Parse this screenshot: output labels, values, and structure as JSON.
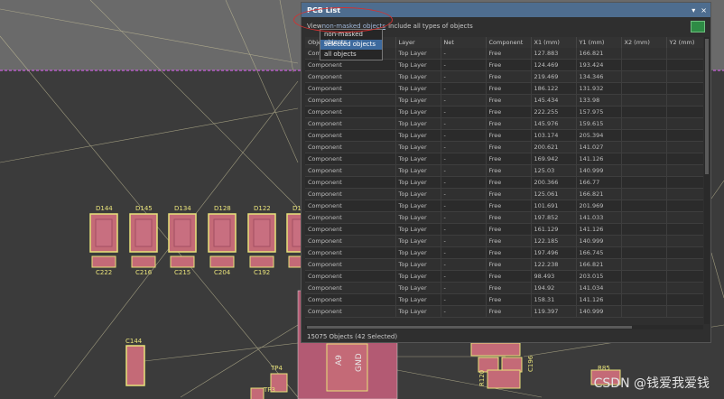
{
  "panel": {
    "title": "PCB List",
    "minimize_glyph": "▾",
    "close_glyph": "×",
    "filter_prefix": "View ",
    "filter_selected": "non-masked objects",
    "filter_include_text": "include all types of objects",
    "export_icon": "excel-export-icon",
    "status": "15075 Objects (42 Selected)"
  },
  "dropdown": {
    "options": [
      "non-masked objects",
      "selected objects",
      "all objects"
    ],
    "highlighted_index": 1
  },
  "table": {
    "columns": [
      "Object Kind",
      "Layer",
      "Net",
      "Component",
      "X1 (mm)",
      "Y1 (mm)",
      "X2 (mm)",
      "Y2 (mm)"
    ],
    "rows": [
      [
        "Component",
        "Top Layer",
        "-",
        "Free",
        "127.883",
        "166.821",
        "",
        ""
      ],
      [
        "Component",
        "Top Layer",
        "-",
        "Free",
        "124.469",
        "193.424",
        "",
        ""
      ],
      [
        "Component",
        "Top Layer",
        "-",
        "Free",
        "219.469",
        "134.346",
        "",
        ""
      ],
      [
        "Component",
        "Top Layer",
        "-",
        "Free",
        "186.122",
        "131.932",
        "",
        ""
      ],
      [
        "Component",
        "Top Layer",
        "-",
        "Free",
        "145.434",
        "133.98",
        "",
        ""
      ],
      [
        "Component",
        "Top Layer",
        "-",
        "Free",
        "222.255",
        "157.975",
        "",
        ""
      ],
      [
        "Component",
        "Top Layer",
        "-",
        "Free",
        "145.976",
        "159.615",
        "",
        ""
      ],
      [
        "Component",
        "Top Layer",
        "-",
        "Free",
        "103.174",
        "205.394",
        "",
        ""
      ],
      [
        "Component",
        "Top Layer",
        "-",
        "Free",
        "200.621",
        "141.027",
        "",
        ""
      ],
      [
        "Component",
        "Top Layer",
        "-",
        "Free",
        "169.942",
        "141.126",
        "",
        ""
      ],
      [
        "Component",
        "Top Layer",
        "-",
        "Free",
        "125.03",
        "140.999",
        "",
        ""
      ],
      [
        "Component",
        "Top Layer",
        "-",
        "Free",
        "200.366",
        "166.77",
        "",
        ""
      ],
      [
        "Component",
        "Top Layer",
        "-",
        "Free",
        "125.061",
        "166.821",
        "",
        ""
      ],
      [
        "Component",
        "Top Layer",
        "-",
        "Free",
        "101.691",
        "201.969",
        "",
        ""
      ],
      [
        "Component",
        "Top Layer",
        "-",
        "Free",
        "197.852",
        "141.033",
        "",
        ""
      ],
      [
        "Component",
        "Top Layer",
        "-",
        "Free",
        "161.129",
        "141.126",
        "",
        ""
      ],
      [
        "Component",
        "Top Layer",
        "-",
        "Free",
        "122.185",
        "140.999",
        "",
        ""
      ],
      [
        "Component",
        "Top Layer",
        "-",
        "Free",
        "197.496",
        "166.745",
        "",
        ""
      ],
      [
        "Component",
        "Top Layer",
        "-",
        "Free",
        "122.238",
        "166.821",
        "",
        ""
      ],
      [
        "Component",
        "Top Layer",
        "-",
        "Free",
        "98.493",
        "203.015",
        "",
        ""
      ],
      [
        "Component",
        "Top Layer",
        "-",
        "Free",
        "194.92",
        "141.034",
        "",
        ""
      ],
      [
        "Component",
        "Top Layer",
        "-",
        "Free",
        "158.31",
        "141.126",
        "",
        ""
      ],
      [
        "Component",
        "Top Layer",
        "-",
        "Free",
        "119.397",
        "140.999",
        "",
        ""
      ]
    ]
  },
  "pcb": {
    "designators": [
      "D144",
      "D145",
      "D134",
      "D128",
      "D122",
      "D1"
    ],
    "capacitors": [
      "C222",
      "C216",
      "C215",
      "C204",
      "C192"
    ],
    "other_labels": [
      "C144",
      "TP4",
      "TP3",
      "R85",
      "C196",
      "R120"
    ],
    "chip_text": [
      "A9",
      "GND"
    ]
  },
  "watermark": "CSDN @钱爱我爱钱"
}
